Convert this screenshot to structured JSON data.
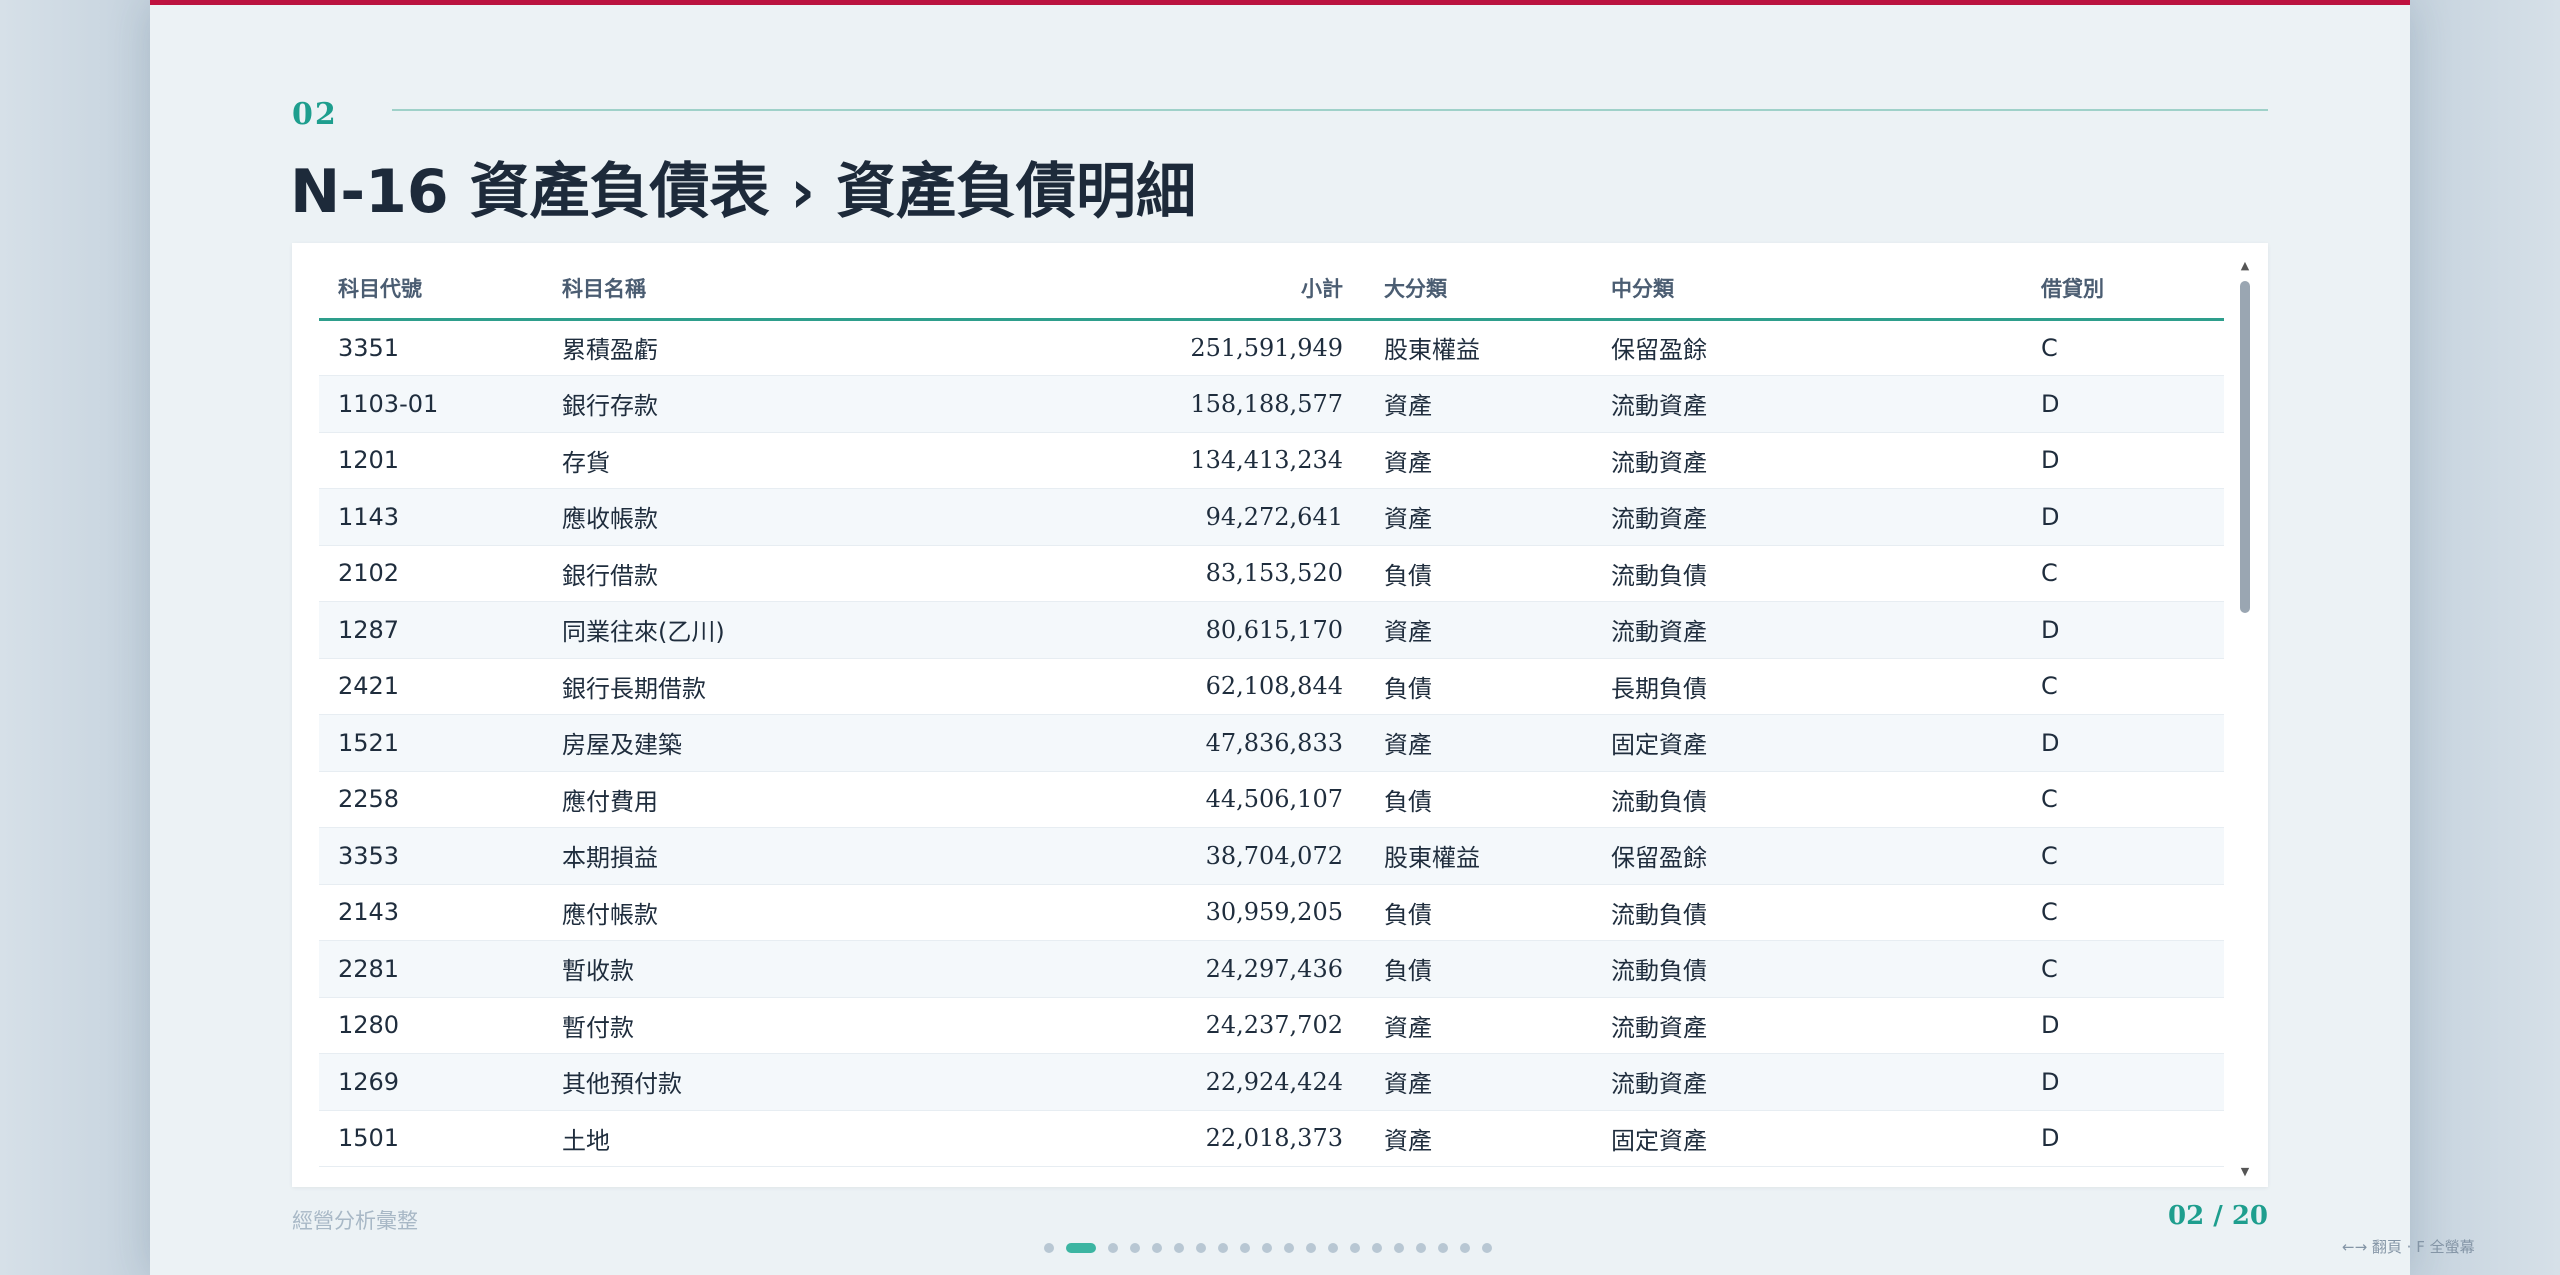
{
  "slide": {
    "number": "02",
    "title": "N-16 資產負債表 › 資產負債明細",
    "footer_label": "經營分析彙整",
    "page_indicator": "02 / 20",
    "keyboard_hint": "←→ 翻頁 · F 全螢幕",
    "total_slides": 20,
    "current_slide": 2
  },
  "table": {
    "columns": [
      "科目代號",
      "科目名稱",
      "小計",
      "大分類",
      "中分類",
      "借貸別"
    ],
    "rows": [
      [
        "3351",
        "累積盈虧",
        "251,591,949",
        "股東權益",
        "保留盈餘",
        "C"
      ],
      [
        "1103-01",
        "銀行存款",
        "158,188,577",
        "資產",
        "流動資產",
        "D"
      ],
      [
        "1201",
        "存貨",
        "134,413,234",
        "資產",
        "流動資產",
        "D"
      ],
      [
        "1143",
        "應收帳款",
        "94,272,641",
        "資產",
        "流動資產",
        "D"
      ],
      [
        "2102",
        "銀行借款",
        "83,153,520",
        "負債",
        "流動負債",
        "C"
      ],
      [
        "1287",
        "同業往來(乙川)",
        "80,615,170",
        "資產",
        "流動資產",
        "D"
      ],
      [
        "2421",
        "銀行長期借款",
        "62,108,844",
        "負債",
        "長期負債",
        "C"
      ],
      [
        "1521",
        "房屋及建築",
        "47,836,833",
        "資產",
        "固定資產",
        "D"
      ],
      [
        "2258",
        "應付費用",
        "44,506,107",
        "負債",
        "流動負債",
        "C"
      ],
      [
        "3353",
        "本期損益",
        "38,704,072",
        "股東權益",
        "保留盈餘",
        "C"
      ],
      [
        "2143",
        "應付帳款",
        "30,959,205",
        "負債",
        "流動負債",
        "C"
      ],
      [
        "2281",
        "暫收款",
        "24,297,436",
        "負債",
        "流動負債",
        "C"
      ],
      [
        "1280",
        "暫付款",
        "24,237,702",
        "資產",
        "流動資產",
        "D"
      ],
      [
        "1269",
        "其他預付款",
        "22,924,424",
        "資產",
        "流動資產",
        "D"
      ],
      [
        "1501",
        "土地",
        "22,018,373",
        "資產",
        "固定資產",
        "D"
      ]
    ]
  },
  "colors": {
    "accent_teal": "#1e9e8e",
    "top_bar": "#c8103e"
  }
}
